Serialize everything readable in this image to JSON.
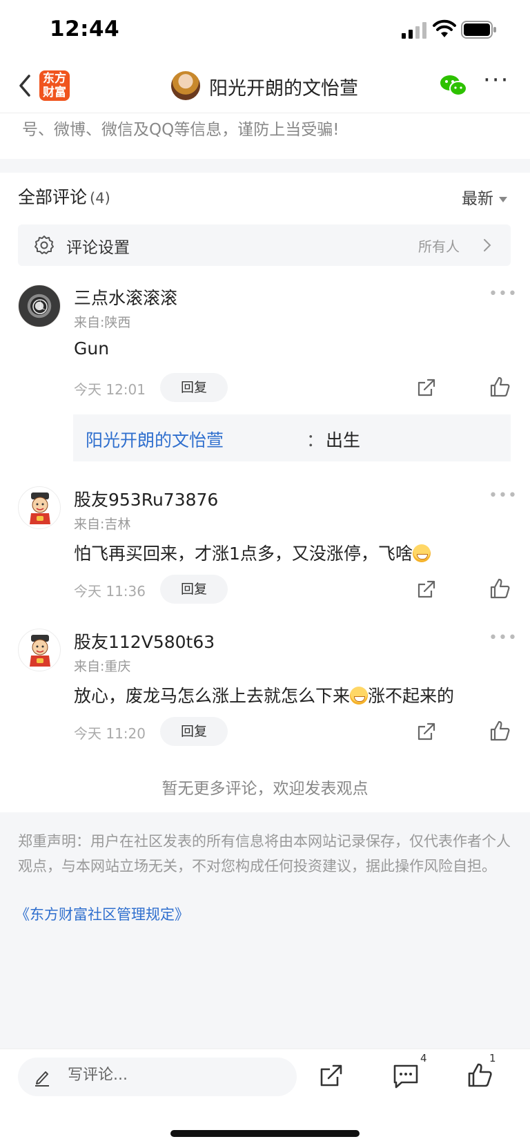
{
  "status_bar": {
    "time": "12:44"
  },
  "nav": {
    "logo_text_line1": "东方",
    "logo_text_line2": "财富",
    "title": "阳光开朗的文怡萱"
  },
  "warning_text": "号、微博、微信及QQ等信息，谨防上当受骗!",
  "comments_header": {
    "title": "全部评论",
    "count": "(4)",
    "sort_label": "最新"
  },
  "comment_settings": {
    "label": "评论设置",
    "value": "所有人"
  },
  "comments": [
    {
      "user": "三点水滚滚滚",
      "from": "来自:陕西",
      "text": "Gun",
      "time": "今天 12:01",
      "reply_label": "回复",
      "sub_reply": {
        "user": "阳光开朗的文怡萱",
        "colon": "：",
        "text": "出生"
      }
    },
    {
      "user": "股友953Ru73876",
      "from": "来自:吉林",
      "text": "怕飞再买回来，才涨1点多，又没涨停，飞啥",
      "time": "今天 11:36",
      "reply_label": "回复"
    },
    {
      "user": "股友112V580t63",
      "from": "来自:重庆",
      "text_before_emoji": "放心，废龙马怎么涨上去就怎么下来",
      "text_after_emoji": "涨不起来的",
      "time": "今天 11:20",
      "reply_label": "回复"
    }
  ],
  "no_more_text": "暂无更多评论，欢迎发表观点",
  "disclaimer": "郑重声明：用户在社区发表的所有信息将由本网站记录保存，仅代表作者个人观点，与本网站立场无关，不对您构成任何投资建议，据此操作风险自担。",
  "rules_link": "《东方财富社区管理规定》",
  "bottom_bar": {
    "compose_placeholder": "写评论...",
    "comment_count": "4",
    "like_count": "1"
  },
  "colors": {
    "brand_orange": "#f0541e",
    "link_blue": "#2f6fce",
    "wechat_green": "#2dc100"
  }
}
